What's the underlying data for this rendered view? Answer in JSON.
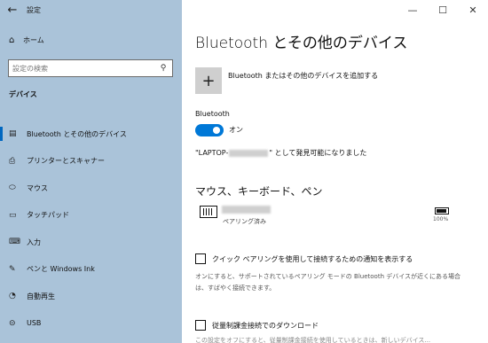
{
  "window": {
    "title": "設定",
    "back_glyph": "←",
    "controls": {
      "minimize": "—",
      "maximize": "☐",
      "close": "✕"
    }
  },
  "sidebar": {
    "home": {
      "label": "ホーム",
      "icon": "home-icon",
      "glyph": "⌂"
    },
    "search": {
      "placeholder": "設定の検索",
      "icon": "search-icon",
      "glyph": "⚲"
    },
    "section_title": "デバイス",
    "items": [
      {
        "label": "Bluetooth とその他のデバイス",
        "icon": "bluetooth-devices-icon",
        "glyph": "▤",
        "selected": true
      },
      {
        "label": "プリンターとスキャナー",
        "icon": "printer-icon",
        "glyph": "⎙",
        "selected": false
      },
      {
        "label": "マウス",
        "icon": "mouse-icon",
        "glyph": "⬭",
        "selected": false
      },
      {
        "label": "タッチパッド",
        "icon": "touchpad-icon",
        "glyph": "▭",
        "selected": false
      },
      {
        "label": "入力",
        "icon": "keyboard-icon",
        "glyph": "⌨",
        "selected": false
      },
      {
        "label": "ペンと Windows Ink",
        "icon": "pen-icon",
        "glyph": "✎",
        "selected": false
      },
      {
        "label": "自動再生",
        "icon": "autoplay-icon",
        "glyph": "◔",
        "selected": false
      },
      {
        "label": "USB",
        "icon": "usb-icon",
        "glyph": "⊝",
        "selected": false
      }
    ]
  },
  "main": {
    "title": "Bluetooth とその他のデバイス",
    "add_device": {
      "glyph": "+",
      "label": "Bluetooth またはその他のデバイスを追加する"
    },
    "bluetooth": {
      "title": "Bluetooth",
      "toggle_state": "オン",
      "discoverable_prefix": "\"LAPTOP-",
      "discoverable_suffix": "\" として発見可能になりました"
    },
    "devices_section": {
      "title": "マウス、キーボード、ペン",
      "device": {
        "status": "ペアリング済み",
        "battery": "100%"
      }
    },
    "swift_pair": {
      "label": "クイック ペアリングを使用して接続するための通知を表示する",
      "checked": false,
      "description": "オンにすると、サポートされているペアリング モードの Bluetooth デバイスが近くにある場合は、すばやく接続できます。"
    },
    "metered": {
      "label": "従量制課金接続でのダウンロード",
      "checked": false,
      "description": "この設定をオフにすると、従量制課金接続を使用しているときは、新しいデバイス..."
    }
  },
  "colors": {
    "sidebar_bg": "#aac3d9",
    "accent": "#0078d7"
  }
}
